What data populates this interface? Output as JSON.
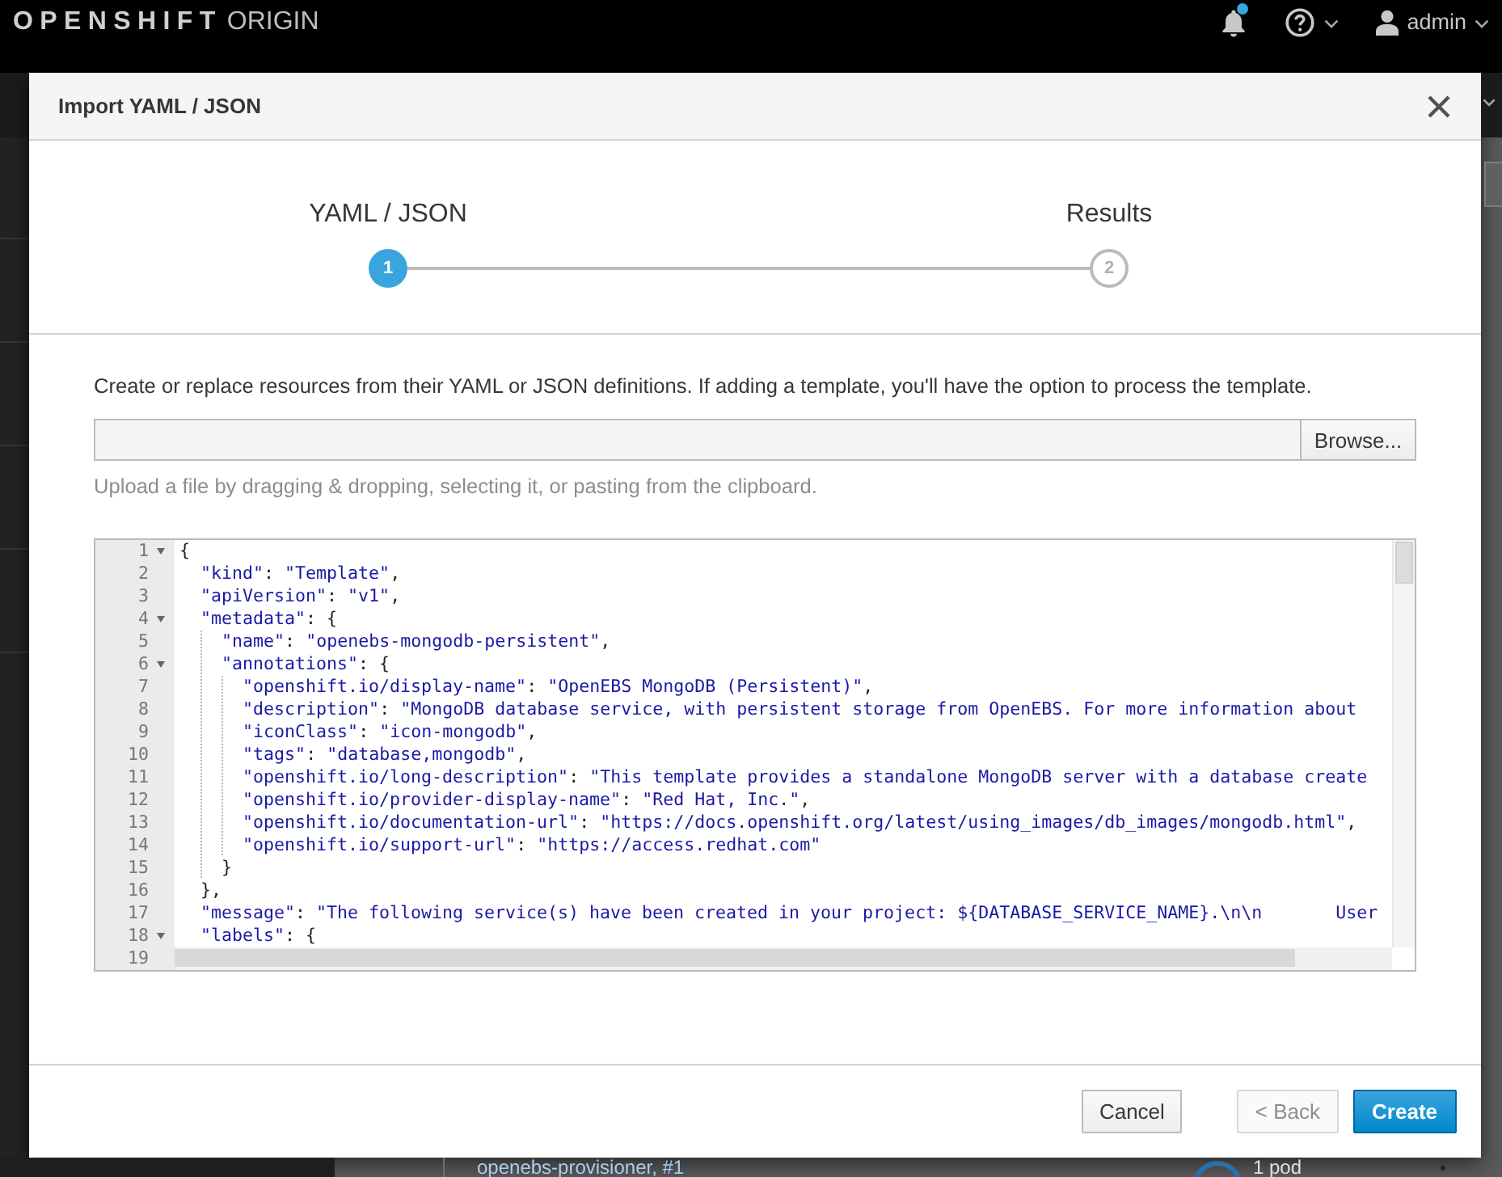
{
  "top_bar": {
    "logo": {
      "brand": "OPENSHIFT",
      "product": "ORIGIN"
    },
    "notifications": {
      "unread": true
    },
    "user": {
      "name": "admin"
    }
  },
  "modal": {
    "title": "Import YAML / JSON",
    "steps": [
      {
        "label": "YAML / JSON",
        "number": "1",
        "selected": true
      },
      {
        "label": "Results",
        "number": "2",
        "selected": false
      }
    ],
    "description": "Create or replace resources from their YAML or JSON definitions. If adding a template, you'll have the option to process the template.",
    "file_field": {
      "button": "Browse..."
    },
    "help_text": "Upload a file by dragging & dropping, selecting it, or pasting from the clipboard.",
    "editor": {
      "lines": [
        {
          "number": "1",
          "text": "{",
          "fold": true
        },
        {
          "number": "2",
          "text": "  \"kind\": \"Template\",",
          "fold": false
        },
        {
          "number": "3",
          "text": "  \"apiVersion\": \"v1\",",
          "fold": false
        },
        {
          "number": "4",
          "text": "  \"metadata\": {",
          "fold": true
        },
        {
          "number": "5",
          "text": "    \"name\": \"openebs-mongodb-persistent\",",
          "fold": false
        },
        {
          "number": "6",
          "text": "    \"annotations\": {",
          "fold": true
        },
        {
          "number": "7",
          "text": "      \"openshift.io/display-name\": \"OpenEBS MongoDB (Persistent)\",",
          "fold": false
        },
        {
          "number": "8",
          "text": "      \"description\": \"MongoDB database service, with persistent storage from OpenEBS. For more information about",
          "fold": false
        },
        {
          "number": "9",
          "text": "      \"iconClass\": \"icon-mongodb\",",
          "fold": false
        },
        {
          "number": "10",
          "text": "      \"tags\": \"database,mongodb\",",
          "fold": false
        },
        {
          "number": "11",
          "text": "      \"openshift.io/long-description\": \"This template provides a standalone MongoDB server with a database create",
          "fold": false
        },
        {
          "number": "12",
          "text": "      \"openshift.io/provider-display-name\": \"Red Hat, Inc.\",",
          "fold": false
        },
        {
          "number": "13",
          "text": "      \"openshift.io/documentation-url\": \"https://docs.openshift.org/latest/using_images/db_images/mongodb.html\",",
          "fold": false
        },
        {
          "number": "14",
          "text": "      \"openshift.io/support-url\": \"https://access.redhat.com\"",
          "fold": false
        },
        {
          "number": "15",
          "text": "    }",
          "fold": false
        },
        {
          "number": "16",
          "text": "  },",
          "fold": false
        },
        {
          "number": "17",
          "text": "  \"message\": \"The following service(s) have been created in your project: ${DATABASE_SERVICE_NAME}.\\n\\n       User",
          "fold": false
        },
        {
          "number": "18",
          "text": "  \"labels\": {",
          "fold": true
        },
        {
          "number": "19",
          "fold": false
        }
      ]
    },
    "footer": {
      "cancel": {
        "label": "Cancel",
        "disabled": false
      },
      "back": {
        "label": "< Back",
        "disabled": true
      },
      "create": {
        "label": "Create",
        "disabled": false
      }
    }
  },
  "background": {
    "list_item": "openebs-provisioner, #1",
    "pod_count": "1 pod"
  }
}
